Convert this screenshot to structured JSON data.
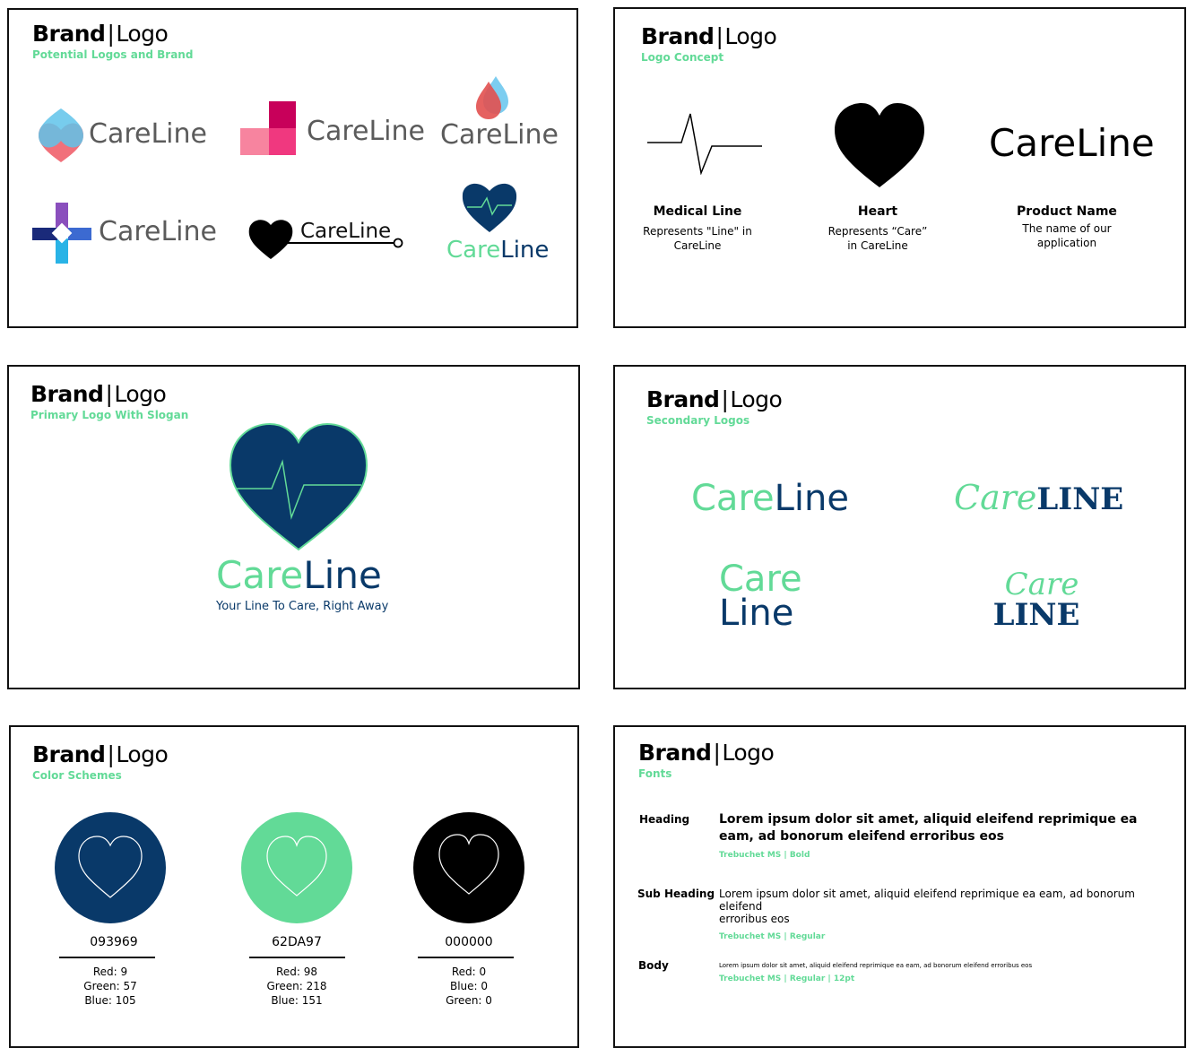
{
  "brand": {
    "bold": "Brand",
    "sep": "|",
    "rest": "Logo"
  },
  "colors": {
    "navy": "#093969",
    "green": "#62DA97",
    "black": "#000000"
  },
  "panel1": {
    "subtitle": "Potential Logos and Brand",
    "logos": [
      "CareLine",
      "CareLine",
      "CareLine",
      "CareLine",
      "CareLine",
      "CareLine"
    ],
    "icons": [
      "overlapping-hearts-logo-icon",
      "pink-squares-logo-icon",
      "blood-drop-logo-icon",
      "medical-cross-logo-icon",
      "heart-line-logo-icon",
      "heart-pulse-logo-icon"
    ]
  },
  "panel2": {
    "subtitle": "Logo Concept",
    "wordmark": "CareLine",
    "items": [
      {
        "title": "Medical Line",
        "desc1": "Represents \"Line\" in",
        "desc2": "CareLine",
        "icon": "pulse-line-icon"
      },
      {
        "title": "Heart",
        "desc1": "Represents “Care”",
        "desc2": "in CareLine",
        "icon": "heart-icon"
      },
      {
        "title": "Product Name",
        "desc1": "The name of our",
        "desc2": "application"
      }
    ]
  },
  "panel3": {
    "subtitle": "Primary Logo With Slogan",
    "care": "Care",
    "line": "Line",
    "slogan": "Your Line To Care, Right Away"
  },
  "panel4": {
    "subtitle": "Secondary Logos",
    "logo1": {
      "care": "Care",
      "line": "Line"
    },
    "logo2": {
      "care": "Care",
      "line": "LINE"
    },
    "logo3": {
      "care": "Care",
      "line": "Line"
    },
    "logo4": {
      "care": "Care",
      "line": "LINE"
    }
  },
  "panel5": {
    "subtitle": "Color Schemes",
    "swatches": [
      {
        "hex": "093969",
        "l1": "Red: 9",
        "l2": "Green: 57",
        "l3": "Blue: 105",
        "color": "#093969",
        "stroke": "#ffffff"
      },
      {
        "hex": "62DA97",
        "l1": "Red: 98",
        "l2": "Green: 218",
        "l3": "Blue: 151",
        "color": "#62DA97",
        "stroke": "#ffffff"
      },
      {
        "hex": "000000",
        "l1": "Red: 0",
        "l2": "Blue: 0",
        "l3": "Green: 0",
        "color": "#000000",
        "stroke": "#ffffff"
      }
    ]
  },
  "panel6": {
    "subtitle": "Fonts",
    "rows": [
      {
        "label": "Heading",
        "line1": "Lorem ipsum dolor sit amet, aliquid eleifend reprimique ea",
        "line2": "eam, ad bonorum eleifend erroribus eos",
        "meta": "Trebuchet MS  |  Bold"
      },
      {
        "label": "Sub Heading",
        "line1": "Lorem ipsum dolor sit amet, aliquid eleifend reprimique ea eam, ad bonorum eleifend",
        "line2": "erroribus eos",
        "meta": "Trebuchet MS  |  Regular"
      },
      {
        "label": "Body",
        "line1": "Lorem ipsum dolor sit amet, aliquid eleifend reprimique ea eam, ad bonorum eleifend erroribus eos",
        "meta": "Trebuchet MS  |  Regular  |  12pt"
      }
    ]
  }
}
